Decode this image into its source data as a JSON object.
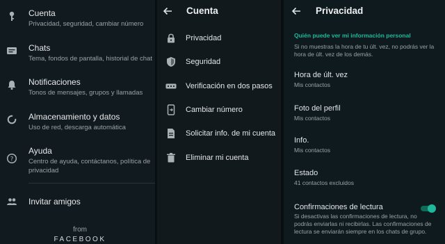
{
  "settings": {
    "items": [
      {
        "icon": "key-icon",
        "title": "Cuenta",
        "subtitle": "Privacidad, seguridad, cambiar número"
      },
      {
        "icon": "chat-icon",
        "title": "Chats",
        "subtitle": "Tema, fondos de pantalla, historial de chat"
      },
      {
        "icon": "bell-icon",
        "title": "Notificaciones",
        "subtitle": "Tonos de mensajes, grupos y llamadas"
      },
      {
        "icon": "data-usage-icon",
        "title": "Almacenamiento y datos",
        "subtitle": "Uso de red, descarga automática"
      },
      {
        "icon": "help-icon",
        "title": "Ayuda",
        "subtitle": "Centro de ayuda, contáctanos, política de privacidad"
      }
    ],
    "invite": {
      "icon": "people-icon",
      "label": "Invitar amigos"
    },
    "from_label": "from",
    "brand_label": "FACEBOOK"
  },
  "account": {
    "title": "Cuenta",
    "items": [
      {
        "icon": "lock-icon",
        "label": "Privacidad"
      },
      {
        "icon": "shield-icon",
        "label": "Seguridad"
      },
      {
        "icon": "dots-icon",
        "label": "Verificación en dos pasos"
      },
      {
        "icon": "phone-swap-icon",
        "label": "Cambiar número"
      },
      {
        "icon": "document-icon",
        "label": "Solicitar info. de mi cuenta"
      },
      {
        "icon": "trash-icon",
        "label": "Eliminar mi cuenta"
      }
    ]
  },
  "privacy": {
    "title": "Privacidad",
    "section_label": "Quién puede ver mi información personal",
    "section_desc": "Si no muestras la hora de tu últ. vez, no podrás ver la hora de últ. vez de los demás.",
    "items": [
      {
        "title": "Hora de últ. vez",
        "value": "Mis contactos"
      },
      {
        "title": "Foto del perfil",
        "value": "Mis contactos"
      },
      {
        "title": "Info.",
        "value": "Mis contactos"
      },
      {
        "title": "Estado",
        "value": "41 contactos excluidos"
      }
    ],
    "read_receipts": {
      "title": "Confirmaciones de lectura",
      "desc": "Si desactivas las confirmaciones de lectura, no podrás enviarlas ni recibirlas. Las confirmaciones de lectura se enviarán siempre en los chats de grupo.",
      "enabled": true
    }
  },
  "colors": {
    "accent": "#1fb89a",
    "background": "#111a1f"
  }
}
